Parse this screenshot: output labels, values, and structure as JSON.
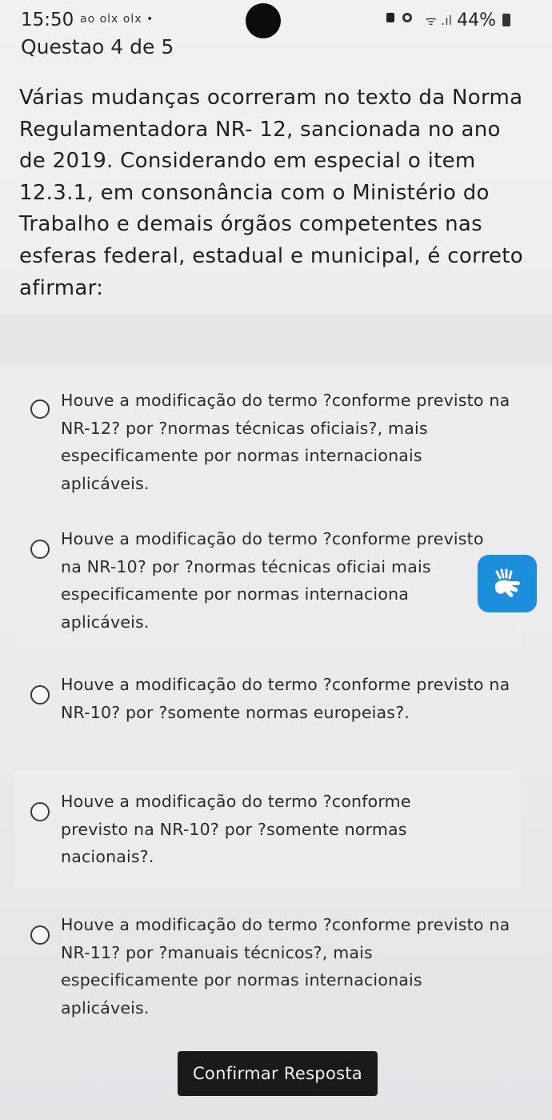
{
  "status_bar": {
    "time": "15:50",
    "app_icons_text": "ao olx olx •",
    "signal_text": "ᯤ .ıl",
    "battery_percent": "44%"
  },
  "question": {
    "number_label": "Questao 4 de 5",
    "text": "Várias mudanças ocorreram no texto da Norma Regulamentadora NR- 12, sancionada no ano de 2019. Considerando em especial o item 12.3.1, em consonância com o Ministério do Trabalho e demais órgãos competentes nas esferas federal, estadual e municipal, é correto afirmar:"
  },
  "options": [
    {
      "text": "Houve a modificação do termo ?conforme previsto na NR-12? por ?normas técnicas oficiais?, mais especificamente por normas internacionais aplicáveis."
    },
    {
      "text": "Houve a modificação do termo ?conforme previsto na NR-10? por ?normas técnicas oficiai mais especificamente por normas internaciona aplicáveis."
    },
    {
      "text": "Houve a modificação do termo ?conforme previsto na NR-10? por ?somente normas europeias?."
    },
    {
      "text": "Houve a modificação do termo ?conforme previsto na NR-10? por ?somente normas nacionais?."
    },
    {
      "text": "Houve a modificação do termo ?conforme previsto na NR-11? por ?manuais técnicos?, mais especificamente por normas internacionais aplicáveis."
    }
  ],
  "accessibility_button": {
    "icon": "sign-language-hand-icon",
    "color": "#1c8fdc"
  },
  "confirm_button": {
    "label": "Confirmar Resposta"
  }
}
